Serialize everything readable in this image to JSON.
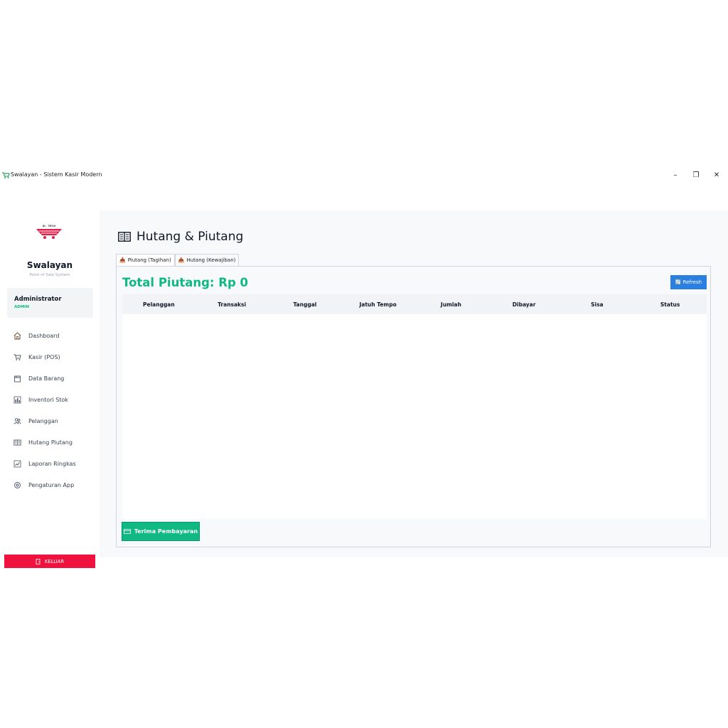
{
  "window": {
    "title": "Swalayan - Sistem Kasir Modern",
    "controls": {
      "minimize": "–",
      "maximize": "❐",
      "close": "✕"
    }
  },
  "sidebar": {
    "logo_text": "ID - TECH",
    "brand": "Swalayan",
    "brand_sub": "Point of Sale System",
    "user": {
      "name": "Administrator",
      "role": "ADMIN"
    },
    "items": [
      {
        "label": "Dashboard",
        "icon": "home-icon"
      },
      {
        "label": "Kasir (POS)",
        "icon": "cart-icon"
      },
      {
        "label": "Data Barang",
        "icon": "box-icon"
      },
      {
        "label": "Inventori Stok",
        "icon": "chart-icon"
      },
      {
        "label": "Pelanggan",
        "icon": "customers-icon"
      },
      {
        "label": "Hutang Piutang",
        "icon": "ledger-icon"
      },
      {
        "label": "Laporan Ringkas",
        "icon": "report-icon"
      },
      {
        "label": "Pengaturan App",
        "icon": "settings-icon"
      }
    ],
    "logout_label": "KELUAR"
  },
  "main": {
    "page_title": "Hutang & Piutang",
    "tabs": [
      {
        "label": "Piutang (Tagihan)",
        "active": true
      },
      {
        "label": "Hutang (Kewajiban)",
        "active": false
      }
    ],
    "total_label": "Total Piutang: Rp 0",
    "refresh_label": "Refresh",
    "table": {
      "columns": [
        "Pelanggan",
        "Transaksi",
        "Tanggal",
        "Jatuh Tempo",
        "Jumlah",
        "Dibayar",
        "Sisa",
        "Status"
      ],
      "rows": []
    },
    "pay_button_label": "Terima Pembayaran"
  },
  "colors": {
    "accent_green": "#10b981",
    "accent_blue": "#2b7fe0",
    "danger_red": "#f0123e",
    "sidebar_card": "#f3f4f6",
    "main_bg": "#f8f9fb"
  }
}
